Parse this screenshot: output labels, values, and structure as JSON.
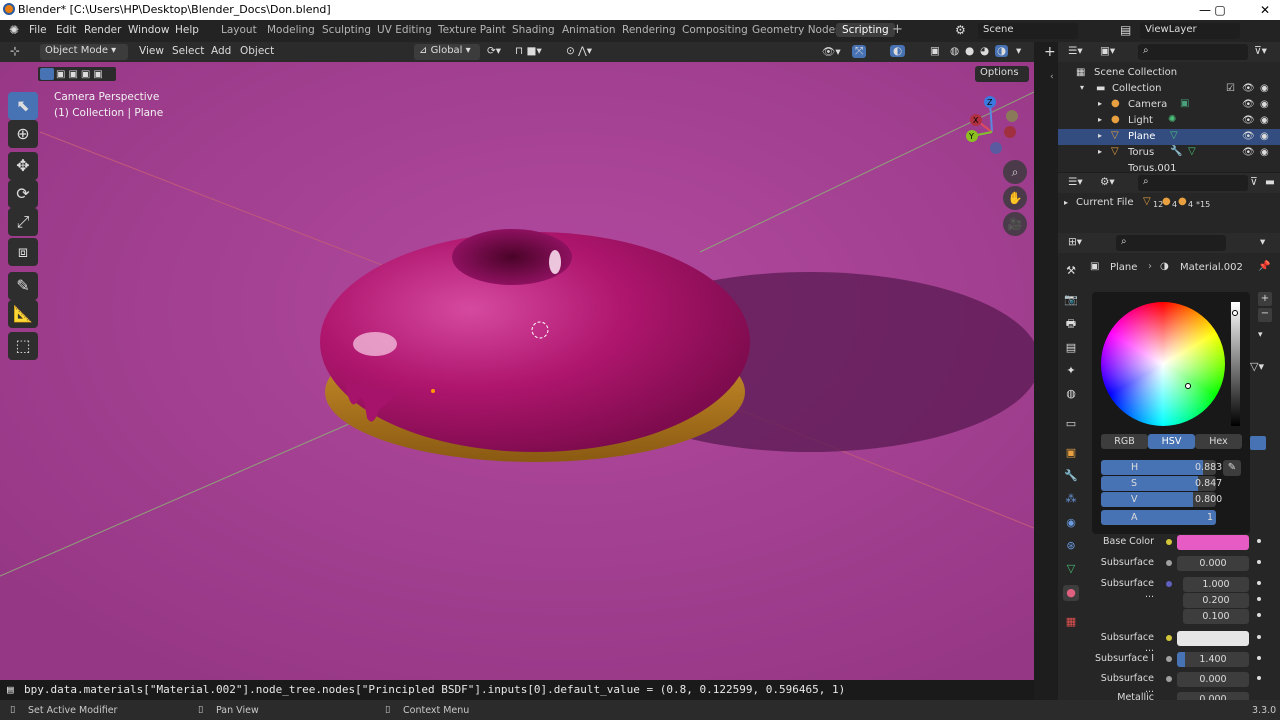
{
  "window": {
    "title": "Blender* [C:\\Users\\HP\\Desktop\\Blender_Docs\\Don.blend]",
    "min": "—",
    "max": "▢",
    "close": "✕"
  },
  "menu": [
    "File",
    "Edit",
    "Render",
    "Window",
    "Help"
  ],
  "workspaces": [
    "Layout",
    "Modeling",
    "Sculpting",
    "UV Editing",
    "Texture Paint",
    "Shading",
    "Animation",
    "Rendering",
    "Compositing",
    "Geometry Nodes",
    "Scripting"
  ],
  "active_workspace": "Scripting",
  "add_tab": "+",
  "scene": {
    "label": "Scene",
    "view_layer": "ViewLayer"
  },
  "viewport_header": {
    "mode": "Object Mode",
    "view": "View",
    "select": "Select",
    "add": "Add",
    "object": "Object",
    "orientation": "Global",
    "options": "Options"
  },
  "viewport_overlay": {
    "line1": "Camera Perspective",
    "line2": "(1) Collection | Plane"
  },
  "gizmo": {
    "z": "Z",
    "x": "X",
    "y": "Y"
  },
  "outliner": {
    "root": "Scene Collection",
    "collection": "Collection",
    "items": [
      {
        "name": "Camera",
        "selected": false
      },
      {
        "name": "Light",
        "selected": false
      },
      {
        "name": "Plane",
        "selected": true
      },
      {
        "name": "Torus",
        "selected": false
      },
      {
        "name": "Torus.001",
        "selected": false
      }
    ]
  },
  "file_browser": {
    "label": "Current File",
    "counts": [
      "12",
      "4",
      "4",
      "15"
    ]
  },
  "properties": {
    "object": "Plane",
    "material": "Material.002",
    "color_modes": [
      "RGB",
      "HSV",
      "Hex"
    ],
    "active_color_mode": "HSV",
    "hsva": [
      {
        "label": "H",
        "value": "0.883"
      },
      {
        "label": "S",
        "value": "0.847"
      },
      {
        "label": "V",
        "value": "0.800"
      },
      {
        "label": "A",
        "value": "1"
      }
    ],
    "base_color_label": "Base Color",
    "base_color_hex": "#e65cc4",
    "rows": [
      {
        "label": "Subsurface",
        "value": "0.000"
      },
      {
        "label": "Subsurface ...",
        "values": [
          "1.000",
          "0.200",
          "0.100"
        ]
      },
      {
        "label": "Subsurface ...",
        "value": ""
      },
      {
        "label": "Subsurface I",
        "value": "1.400"
      },
      {
        "label": "Subsurface ...",
        "value": "0.000"
      },
      {
        "label": "Metallic",
        "value": "0.000"
      }
    ]
  },
  "command_line": "bpy.data.materials[\"Material.002\"].node_tree.nodes[\"Principled BSDF\"].inputs[0].default_value = (0.8, 0.122599, 0.596465, 1)",
  "status": {
    "left": "Set Active Modifier",
    "middle": "Pan View",
    "right": "Context Menu",
    "version": "3.3.0"
  },
  "colors": {
    "accent": "#4772b3",
    "viewport_bg": "#a43f92",
    "icing": "#b0166e",
    "dough": "#c98a24"
  }
}
